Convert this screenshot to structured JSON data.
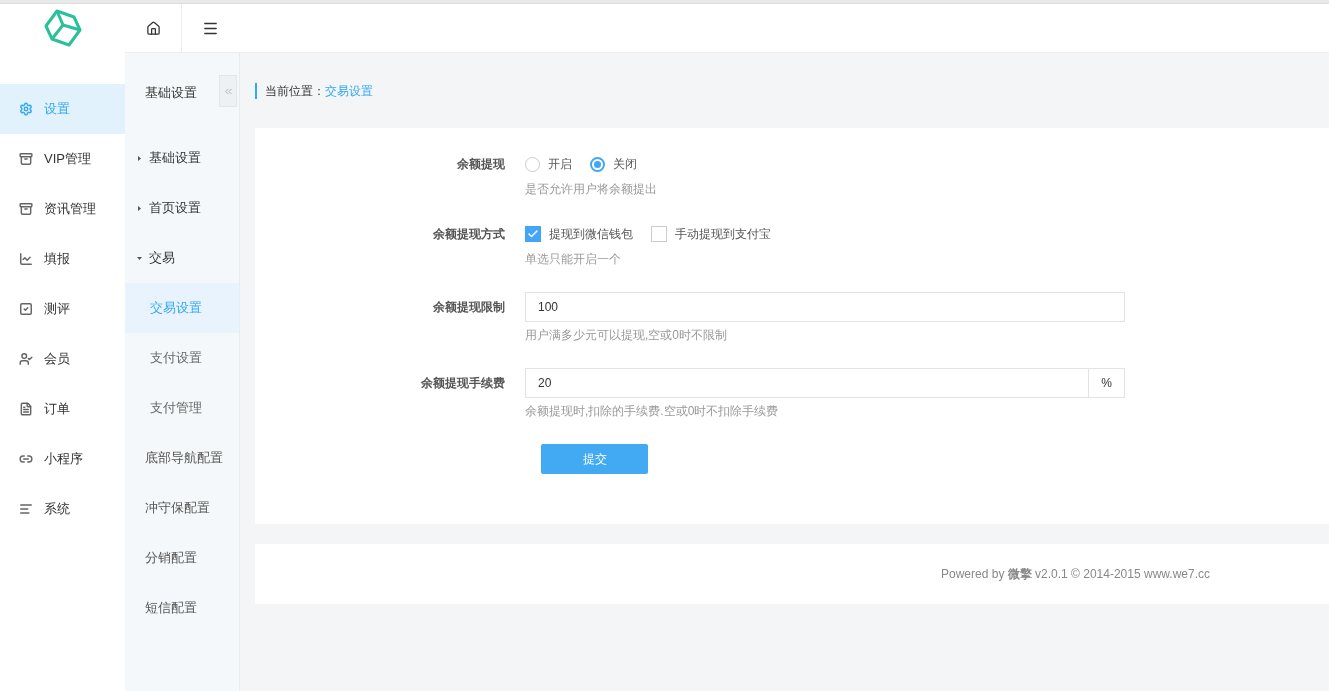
{
  "sidebar": {
    "items": [
      {
        "label": "设置",
        "selected": true
      },
      {
        "label": "VIP管理",
        "selected": false
      },
      {
        "label": "资讯管理",
        "selected": false
      },
      {
        "label": "填报",
        "selected": false
      },
      {
        "label": "测评",
        "selected": false
      },
      {
        "label": "会员",
        "selected": false
      },
      {
        "label": "订单",
        "selected": false
      },
      {
        "label": "小程序",
        "selected": false
      },
      {
        "label": "系统",
        "selected": false
      }
    ]
  },
  "submenu": {
    "title": "基础设置",
    "items": [
      {
        "label": "基础设置",
        "kind": "group",
        "expanded": false
      },
      {
        "label": "首页设置",
        "kind": "group",
        "expanded": false
      },
      {
        "label": "交易",
        "kind": "group",
        "expanded": true,
        "children": [
          {
            "label": "交易设置",
            "selected": true
          },
          {
            "label": "支付设置",
            "selected": false
          },
          {
            "label": "支付管理",
            "selected": false
          }
        ]
      },
      {
        "label": "底部导航配置",
        "kind": "link",
        "selected": false
      },
      {
        "label": "冲守保配置",
        "kind": "link",
        "selected": false
      },
      {
        "label": "分销配置",
        "kind": "link",
        "selected": false
      },
      {
        "label": "短信配置",
        "kind": "link",
        "selected": false
      }
    ]
  },
  "breadcrumb": {
    "prefix": "当前位置：",
    "current": "交易设置"
  },
  "form": {
    "rows": [
      {
        "kind": "radio",
        "label": "余额提现",
        "options": [
          {
            "label": "开启",
            "selected": false
          },
          {
            "label": "关闭",
            "selected": true
          }
        ],
        "help": "是否允许用户将余额提出"
      },
      {
        "kind": "checkbox",
        "label": "余额提现方式",
        "options": [
          {
            "label": "提现到微信钱包",
            "checked": true
          },
          {
            "label": "手动提现到支付宝",
            "checked": false
          }
        ],
        "help": "单选只能开启一个"
      },
      {
        "kind": "text",
        "label": "余额提现限制",
        "value": "100",
        "help": "用户满多少元可以提现,空或0时不限制"
      },
      {
        "kind": "text",
        "label": "余额提现手续费",
        "value": "20",
        "addon": "%",
        "help": "余额提现时,扣除的手续费.空或0时不扣除手续费"
      }
    ],
    "submit": "提交"
  },
  "footer": "Powered by **微擎** v2.0.1 © 2014-2015 www.we7.cc"
}
